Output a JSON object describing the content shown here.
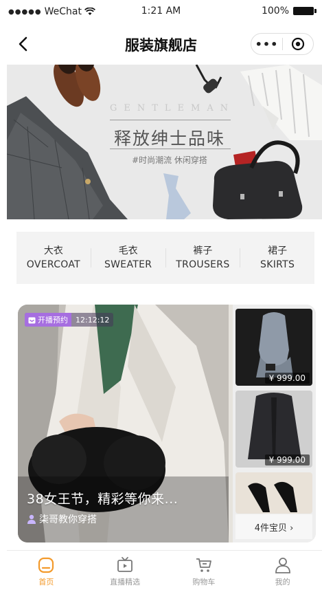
{
  "status_bar": {
    "carrier": "WeChat",
    "time": "1:21 AM",
    "battery": "100%"
  },
  "nav": {
    "title": "服装旗舰店",
    "more_label": "•••"
  },
  "banner": {
    "english": "GENTLEMAN",
    "headline": "释放绅士品味",
    "tagline": "#时尚潮流 休闲穿搭"
  },
  "categories": [
    {
      "zh": "大衣",
      "en": "OVERCOAT"
    },
    {
      "zh": "毛衣",
      "en": "SWEATER"
    },
    {
      "zh": "裤子",
      "en": "TROUSERS"
    },
    {
      "zh": "裙子",
      "en": "SKIRTS"
    }
  ],
  "live": {
    "badge_label": "开播预约",
    "badge_time": "12:12:12",
    "title": "38女王节，精彩等你来...",
    "host": "柒哥教你穿搭",
    "products": [
      {
        "price": "¥ 999.00"
      },
      {
        "price": "¥ 999.00"
      }
    ],
    "item_count": "4件宝贝 ›"
  },
  "tabs": [
    {
      "label": "首页",
      "icon": "home-icon",
      "active": true
    },
    {
      "label": "直播精选",
      "icon": "tv-icon",
      "active": false
    },
    {
      "label": "购物车",
      "icon": "cart-icon",
      "active": false
    },
    {
      "label": "我的",
      "icon": "user-icon",
      "active": false
    }
  ],
  "colors": {
    "accent": "#f39a2b",
    "live_tag": "#a66ee0"
  }
}
